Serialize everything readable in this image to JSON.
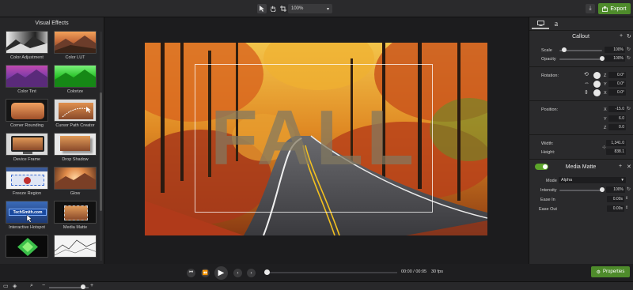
{
  "toolbar": {
    "zoom_value": "100%",
    "export_label": "Export",
    "tools": [
      "arrow-select-icon",
      "hand-pan-icon",
      "crop-icon"
    ]
  },
  "visual_effects": {
    "title": "Visual Effects",
    "items": [
      {
        "label": "Color Adjustment"
      },
      {
        "label": "Color LUT"
      },
      {
        "label": "Color Tint"
      },
      {
        "label": "Colorize"
      },
      {
        "label": "Corner Rounding"
      },
      {
        "label": "Cursor Path Creator"
      },
      {
        "label": "Device Frame"
      },
      {
        "label": "Drop Shadow"
      },
      {
        "label": "Freeze Region"
      },
      {
        "label": "Glow"
      },
      {
        "label": "Interactive Hotspot",
        "thumb_text": "TechSmith.com"
      },
      {
        "label": "Media Matte"
      },
      {
        "label": ""
      },
      {
        "label": ""
      }
    ]
  },
  "canvas": {
    "overlay_text": "FALL"
  },
  "properties": {
    "callout": {
      "title": "Callout",
      "scale_label": "Scale",
      "scale_value": "100%",
      "scale_level": 0.12,
      "opacity_label": "Opacity",
      "opacity_value": "100%",
      "opacity_level": 1.0,
      "rotation_label": "Rotation:",
      "rotation": {
        "z": "0.0°",
        "y": "0.0°",
        "x": "0.0°"
      },
      "position_label": "Position:",
      "position": {
        "x": "-15.0",
        "y": "6.0",
        "z": "0.0"
      },
      "width_label": "Width:",
      "width_value": "1,341.0",
      "height_label": "Height:",
      "height_value": "838.1"
    },
    "media_matte": {
      "title": "Media Matte",
      "enabled": true,
      "mode_label": "Mode",
      "mode_value": "Alpha",
      "intensity_label": "Intensity",
      "intensity_value": "100%",
      "intensity_level": 1.0,
      "ease_in_label": "Ease In",
      "ease_in_value": "0.00s",
      "ease_out_label": "Ease Out",
      "ease_out_value": "0.00s"
    },
    "button_label": "Properties"
  },
  "playback": {
    "time": "00:00 / 00:05",
    "fps": "30 fps",
    "progress": 0.0
  },
  "colors": {
    "accent_green": "#4e8b2b",
    "toggle_green": "#5ca52a"
  }
}
